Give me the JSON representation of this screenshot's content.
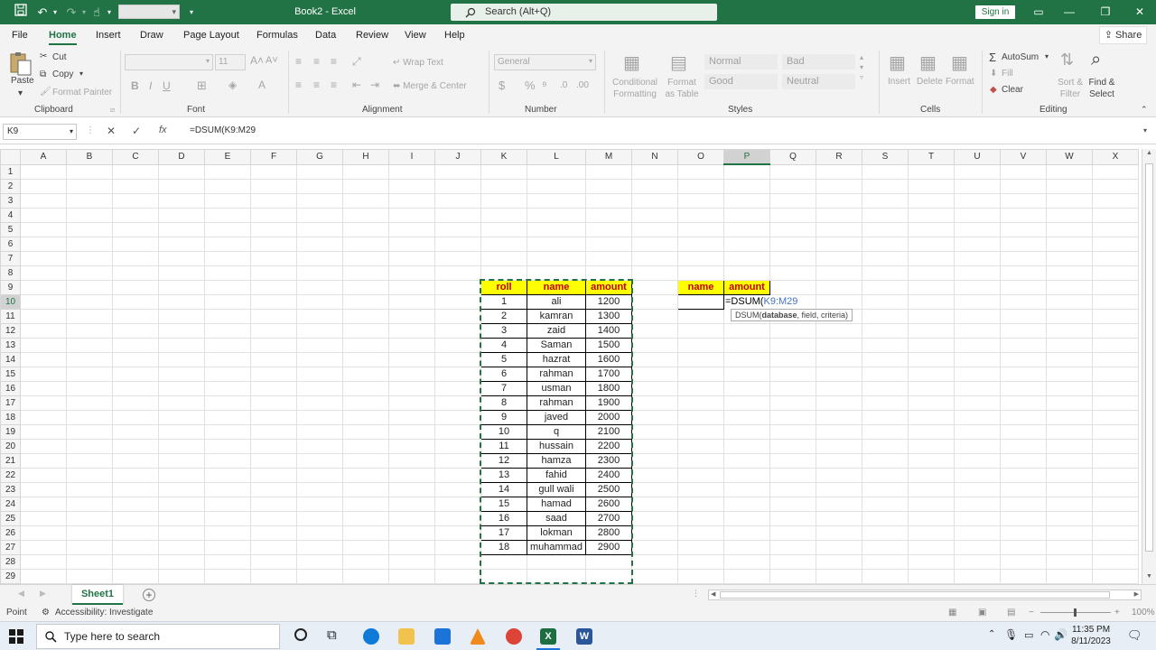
{
  "titlebar": {
    "doc_title": "Book2  -  Excel",
    "search_placeholder": "Search (Alt+Q)",
    "signin_label": "Sign in"
  },
  "ribbon_tabs": [
    "File",
    "Home",
    "Insert",
    "Draw",
    "Page Layout",
    "Formulas",
    "Data",
    "Review",
    "View",
    "Help"
  ],
  "share_label": "Share",
  "ribbon": {
    "clipboard": {
      "paste": "Paste",
      "cut": "Cut",
      "copy": "Copy",
      "format_painter": "Format Painter",
      "label": "Clipboard"
    },
    "font": {
      "size": "11",
      "label": "Font"
    },
    "alignment": {
      "wrap_text": "Wrap Text",
      "merge_center": "Merge & Center",
      "label": "Alignment"
    },
    "number": {
      "format": "General",
      "label": "Number"
    },
    "styles": {
      "conditional": "Conditional Formatting",
      "format_as_table": "Format as Table",
      "normal": "Normal",
      "bad": "Bad",
      "good": "Good",
      "neutral": "Neutral",
      "label": "Styles"
    },
    "cells": {
      "insert": "Insert",
      "delete": "Delete",
      "format": "Format",
      "label": "Cells"
    },
    "editing": {
      "autosum": "AutoSum",
      "fill": "Fill",
      "clear": "Clear",
      "sort_filter": "Sort & Filter",
      "find_select": "Find & Select",
      "label": "Editing"
    }
  },
  "formula_bar": {
    "name_box": "K9",
    "formula": "=DSUM(K9:M29"
  },
  "columns": [
    "A",
    "B",
    "C",
    "D",
    "E",
    "F",
    "G",
    "H",
    "I",
    "J",
    "K",
    "L",
    "M",
    "N",
    "O",
    "P",
    "Q",
    "R",
    "S",
    "T",
    "U",
    "V",
    "W",
    "X"
  ],
  "rows": [
    "1",
    "2",
    "3",
    "4",
    "5",
    "6",
    "7",
    "8",
    "9",
    "10",
    "11",
    "12",
    "13",
    "14",
    "15",
    "16",
    "17",
    "18",
    "19",
    "20",
    "21",
    "22",
    "23",
    "24",
    "25",
    "26",
    "27",
    "28",
    "29"
  ],
  "table": {
    "headers": [
      "roll",
      "name",
      "amount"
    ],
    "data": [
      [
        "1",
        "ali",
        "1200"
      ],
      [
        "2",
        "kamran",
        "1300"
      ],
      [
        "3",
        "zaid",
        "1400"
      ],
      [
        "4",
        "Saman",
        "1500"
      ],
      [
        "5",
        "hazrat",
        "1600"
      ],
      [
        "6",
        "rahman",
        "1700"
      ],
      [
        "7",
        "usman",
        "1800"
      ],
      [
        "8",
        "rahman",
        "1900"
      ],
      [
        "9",
        "javed",
        "2000"
      ],
      [
        "10",
        "q",
        "2100"
      ],
      [
        "11",
        "hussain",
        "2200"
      ],
      [
        "12",
        "hamza",
        "2300"
      ],
      [
        "13",
        "fahid",
        "2400"
      ],
      [
        "14",
        "gull wali",
        "2500"
      ],
      [
        "15",
        "hamad",
        "2600"
      ],
      [
        "16",
        "saad",
        "2700"
      ],
      [
        "17",
        "lokman",
        "2800"
      ],
      [
        "18",
        "muhammad",
        "2900"
      ]
    ]
  },
  "criteria": {
    "headers": [
      "name",
      "amount"
    ],
    "editing_prefix": "=DSUM(",
    "editing_ref": "K9:M29",
    "tooltip_fn": "DSUM(",
    "tooltip_arg1": "database",
    "tooltip_rest": ", field, criteria)"
  },
  "sheet_tab": "Sheet1",
  "status": {
    "mode": "Point",
    "accessibility": "Accessibility: Investigate",
    "zoom": "100%"
  },
  "taskbar": {
    "search_placeholder": "Type here to search",
    "time": "11:35 PM",
    "date": "8/11/2023"
  },
  "colors": {
    "excel_green": "#217346",
    "header_yellow": "#ffff00",
    "header_text_red": "#c00000"
  }
}
